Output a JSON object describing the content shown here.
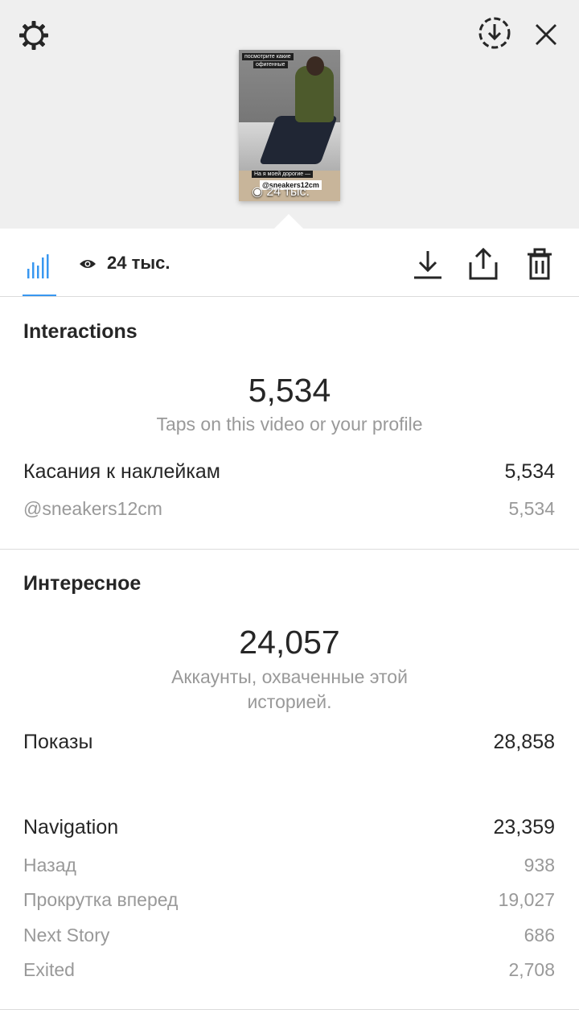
{
  "preview": {
    "tags": [
      "посмотрите какие",
      "офигенные",
      "На я моей дорогие —"
    ],
    "mention": "@sneakers12cm",
    "views_overlay": "24 тыс."
  },
  "toolbar": {
    "views": "24 тыс."
  },
  "interactions": {
    "title": "Interactions",
    "total": "5,534",
    "caption": "Taps on this video or your profile",
    "rows": [
      {
        "label": "Касания к наклейкам",
        "value": "5,534"
      }
    ],
    "subrows": [
      {
        "label": "@sneakers12cm",
        "value": "5,534"
      }
    ]
  },
  "discovery": {
    "title": "Интересное",
    "total": "24,057",
    "caption": "Аккаунты, охваченные этой историей.",
    "impressions": {
      "label": "Показы",
      "value": "28,858"
    },
    "navigation": {
      "label": "Navigation",
      "value": "23,359"
    },
    "nav_items": [
      {
        "label": "Назад",
        "value": "938"
      },
      {
        "label": "Прокрутка вперед",
        "value": "19,027"
      },
      {
        "label": "Next Story",
        "value": "686"
      },
      {
        "label": "Exited",
        "value": "2,708"
      }
    ]
  },
  "colors": {
    "accent": "#3897f0",
    "muted": "#999999",
    "text": "#262626"
  }
}
